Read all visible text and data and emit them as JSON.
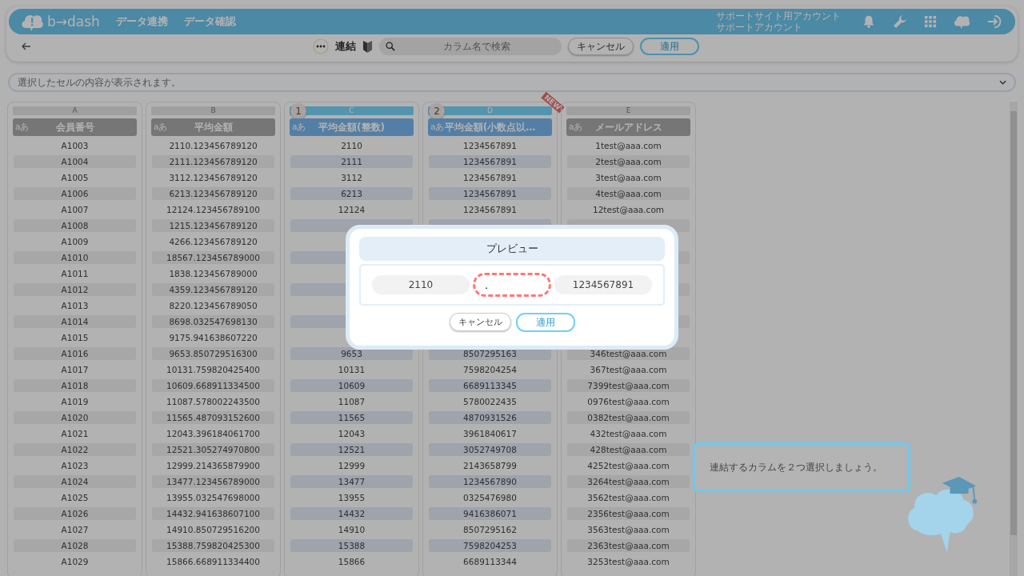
{
  "header": {
    "logo": "b→dash",
    "nav": [
      "データ連携",
      "データ確認"
    ],
    "account": [
      "サポートサイト用アカウント",
      "サポートアカウント"
    ]
  },
  "toolbar": {
    "title": "連結",
    "search": {
      "placeholder": "カラム名で検索"
    },
    "buttons": [
      {
        "label": "キャンセル",
        "kind": "secondary"
      },
      {
        "label": "適用",
        "kind": "primary"
      }
    ]
  },
  "cell_viewer": {
    "placeholder": "選択したセルの内容が表示されます。"
  },
  "columns": [
    {
      "letter": "A",
      "type": "aあ",
      "name": "会員番号",
      "selected": false,
      "cells": [
        "A1003",
        "A1004",
        "A1005",
        "A1006",
        "A1007",
        "A1008",
        "A1009",
        "A1010",
        "A1011",
        "A1012",
        "A1013",
        "A1014",
        "A1015",
        "A1016",
        "A1017",
        "A1018",
        "A1019",
        "A1020",
        "A1021",
        "A1022",
        "A1023",
        "A1024",
        "A1025",
        "A1026",
        "A1027",
        "A1028",
        "A1029"
      ]
    },
    {
      "letter": "B",
      "type": "aあ",
      "name": "平均金額",
      "selected": false,
      "cells": [
        "2110.123456789120",
        "2111.123456789120",
        "3112.123456789120",
        "6213.123456789120",
        "12124.123456789100",
        "1215.123456789120",
        "4266.123456789120",
        "18567.123456789000",
        "1838.123456789000",
        "4359.123456789120",
        "8220.123456789050",
        "8698.032547698130",
        "9175.941638607220",
        "9653.850729516300",
        "10131.759820425400",
        "10609.668911334500",
        "11087.578002243500",
        "11565.487093152600",
        "12043.396184061700",
        "12521.305274970800",
        "12999.214365879900",
        "13477.123456789000",
        "13955.032547698000",
        "14432.941638607100",
        "14910.850729516200",
        "15388.759820425300",
        "15866.668911334400"
      ]
    },
    {
      "letter": "C",
      "type": "aあ",
      "name": "平均金額(整数)",
      "selected": true,
      "badge": "1",
      "cells": [
        "2110",
        "2111",
        "3112",
        "6213",
        "12124",
        null,
        null,
        null,
        null,
        null,
        null,
        null,
        null,
        "9653",
        "10131",
        "10609",
        "11087",
        "11565",
        "12043",
        "12521",
        "12999",
        "13477",
        "13955",
        "14432",
        "14910",
        "15388",
        "15866"
      ]
    },
    {
      "letter": "D",
      "type": "aあ",
      "name": "平均金額(小数点以…",
      "selected": true,
      "badge": "2",
      "ribbon": "NEW",
      "cells": [
        "1234567891",
        "1234567891",
        "1234567891",
        "1234567891",
        "1234567891",
        null,
        null,
        null,
        null,
        null,
        null,
        null,
        null,
        "8507295163",
        "7598204254",
        "6689113345",
        "5780022435",
        "4870931526",
        "3961840617",
        "3052749708",
        "2143658799",
        "1234567890",
        "0325476980",
        "9416386071",
        "8507295162",
        "7598204253",
        "6689113344"
      ]
    },
    {
      "letter": "E",
      "type": "aあ",
      "name": "メールアドレス",
      "selected": false,
      "cells": [
        "1test@aaa.com",
        "2test@aaa.com",
        "3test@aaa.com",
        "4test@aaa.com",
        "12test@aaa.com",
        null,
        null,
        null,
        null,
        null,
        null,
        null,
        null,
        "346test@aaa.com",
        "367test@aaa.com",
        "7399test@aaa.com",
        "0976test@aaa.com",
        "0382test@aaa.com",
        "432test@aaa.com",
        "428test@aaa.com",
        "4252test@aaa.com",
        "3264test@aaa.com",
        "3562test@aaa.com",
        "2356test@aaa.com",
        "3563test@aaa.com",
        "2363test@aaa.com",
        "3253test@aaa.com"
      ]
    }
  ],
  "modal": {
    "title": "プレビュー",
    "parts": [
      {
        "text": "2110",
        "kind": "value"
      },
      {
        "text": ".",
        "kind": "separator"
      },
      {
        "text": "1234567891",
        "kind": "value"
      }
    ],
    "buttons": [
      {
        "label": "キャンセル",
        "kind": "secondary"
      },
      {
        "label": "適用",
        "kind": "primary"
      }
    ]
  },
  "hint": {
    "text": "連結するカラムを２つ選択しましょう。"
  }
}
